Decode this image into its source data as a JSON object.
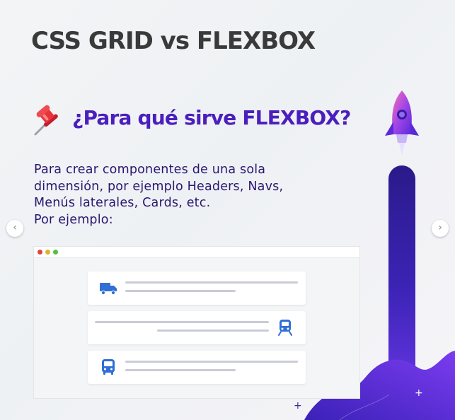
{
  "title": "CSS GRID vs FLEXBOX",
  "subtitle": "¿Para qué sirve FLEXBOX?",
  "body_lines": [
    "Para crear componentes de una sola",
    "dimensión, por ejemplo Headers, Navs,",
    "Menús laterales, Cards, etc.",
    "Por ejemplo:"
  ],
  "nav": {
    "prev": "‹",
    "next": "›"
  },
  "decor": {
    "plus": "+"
  },
  "colors": {
    "title": "#3a3a3a",
    "accent": "#4b1fbd",
    "body_text": "#2a1670",
    "icon_blue": "#2f6fd6",
    "window_dots": [
      "#e0443e",
      "#dfb133",
      "#55c13f"
    ]
  },
  "mockup": {
    "cards": [
      {
        "icon": "truck-icon",
        "icon_side": "left"
      },
      {
        "icon": "train-icon",
        "icon_side": "right"
      },
      {
        "icon": "bus-icon",
        "icon_side": "left"
      }
    ]
  }
}
